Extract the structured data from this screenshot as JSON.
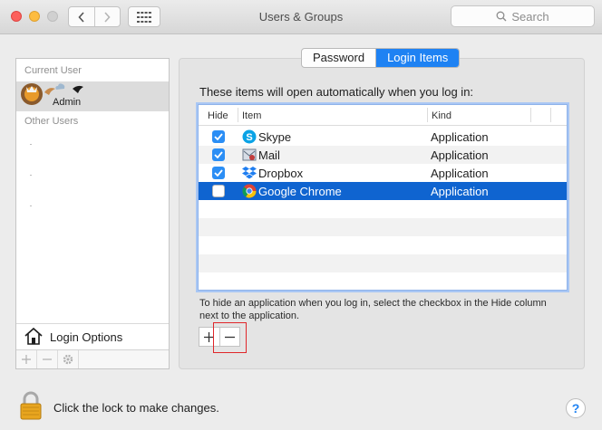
{
  "window": {
    "title": "Users & Groups"
  },
  "search": {
    "placeholder": "Search"
  },
  "sidebar": {
    "current_user_header": "Current User",
    "current_user_name": "Admin",
    "other_users_header": "Other Users",
    "login_options_label": "Login Options"
  },
  "tabs": [
    {
      "label": "Password",
      "selected": false
    },
    {
      "label": "Login Items",
      "selected": true
    }
  ],
  "login_items": {
    "heading": "These items will open automatically when you log in:",
    "columns": {
      "hide": "Hide",
      "item": "Item",
      "kind": "Kind"
    },
    "rows": [
      {
        "hide": true,
        "name": "Skype",
        "icon": "skype-icon",
        "kind": "Application"
      },
      {
        "hide": true,
        "name": "Mail",
        "icon": "mail-icon",
        "kind": "Application"
      },
      {
        "hide": true,
        "name": "Dropbox",
        "icon": "dropbox-icon",
        "kind": "Application"
      },
      {
        "hide": false,
        "name": "Google Chrome",
        "icon": "chrome-icon",
        "kind": "Application",
        "selected": true
      }
    ],
    "hint": "To hide an application when you log in, select the checkbox in the Hide column next to the application."
  },
  "footer": {
    "lock_text": "Click the lock to make changes.",
    "help_label": "?"
  },
  "colors": {
    "accent": "#1e82f3",
    "selection": "#0f64d0",
    "highlight_box": "#e0262a"
  }
}
